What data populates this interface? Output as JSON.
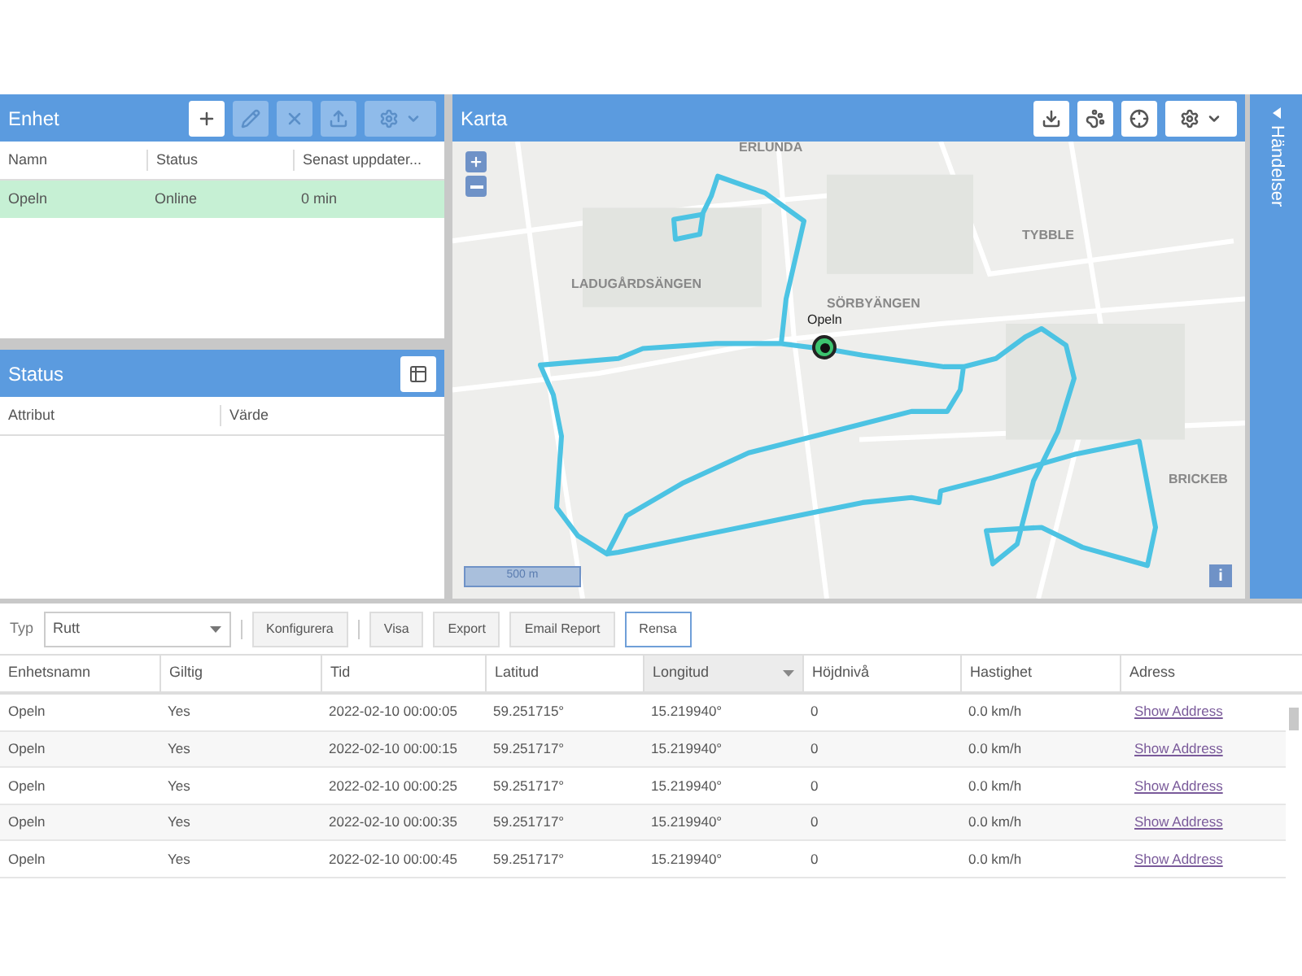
{
  "devices_panel": {
    "title": "Enhet",
    "tools": [
      {
        "kind": "add",
        "disabled": false
      },
      {
        "kind": "edit",
        "disabled": true
      },
      {
        "kind": "remove",
        "disabled": true
      },
      {
        "kind": "upload",
        "disabled": true
      },
      {
        "kind": "settings",
        "disabled": true
      }
    ],
    "columns": [
      "Namn",
      "Status",
      "Senast uppdater..."
    ],
    "rows": [
      {
        "cells": [
          "Opeln",
          "Online",
          "0 min"
        ],
        "selected": true
      }
    ]
  },
  "status_panel": {
    "title": "Status",
    "columns": [
      "Attribut",
      "Värde"
    ]
  },
  "map": {
    "title": "Karta",
    "tools": [
      {
        "kind": "download"
      },
      {
        "kind": "paw"
      },
      {
        "kind": "locate"
      },
      {
        "kind": "settings"
      }
    ],
    "places": [
      "ERLUNDA",
      "LADUGÅRDSÄNGEN",
      "TYBBLE",
      "SÖRBYÄNGEN",
      "BRICKEB"
    ],
    "marker": "Opeln",
    "scale": "500 m",
    "info": "i"
  },
  "events_sidebar": {
    "title": "Händelser"
  },
  "report": {
    "type_label": "Typ",
    "type_value": "Rutt",
    "buttons": [
      {
        "label": "Konfigurera",
        "selected": false
      },
      {
        "label": "Visa",
        "selected": false
      },
      {
        "label": "Export",
        "selected": false
      },
      {
        "label": "Email Report",
        "selected": false
      },
      {
        "label": "Rensa",
        "selected": true
      }
    ],
    "columns": [
      {
        "label": "Enhetsnamn",
        "kind": "text",
        "sorted": false
      },
      {
        "label": "Giltig",
        "kind": "text",
        "sorted": false
      },
      {
        "label": "Tid",
        "kind": "text",
        "sorted": false
      },
      {
        "label": "Latitud",
        "kind": "text",
        "sorted": false
      },
      {
        "label": "Longitud",
        "kind": "text",
        "sorted": true
      },
      {
        "label": "Höjdnivå",
        "kind": "text",
        "sorted": false
      },
      {
        "label": "Hastighet",
        "kind": "text",
        "sorted": false
      },
      {
        "label": "Adress",
        "kind": "link",
        "sorted": false
      }
    ],
    "rows": [
      [
        "Opeln",
        "Yes",
        "2022-02-10 00:00:05",
        "59.251715°",
        "15.219940°",
        "0",
        "0.0 km/h",
        "Show Address"
      ],
      [
        "Opeln",
        "Yes",
        "2022-02-10 00:00:15",
        "59.251717°",
        "15.219940°",
        "0",
        "0.0 km/h",
        "Show Address"
      ],
      [
        "Opeln",
        "Yes",
        "2022-02-10 00:00:25",
        "59.251717°",
        "15.219940°",
        "0",
        "0.0 km/h",
        "Show Address"
      ],
      [
        "Opeln",
        "Yes",
        "2022-02-10 00:00:35",
        "59.251717°",
        "15.219940°",
        "0",
        "0.0 km/h",
        "Show Address"
      ],
      [
        "Opeln",
        "Yes",
        "2022-02-10 00:00:45",
        "59.251717°",
        "15.219940°",
        "0",
        "0.0 km/h",
        "Show Address"
      ]
    ]
  }
}
